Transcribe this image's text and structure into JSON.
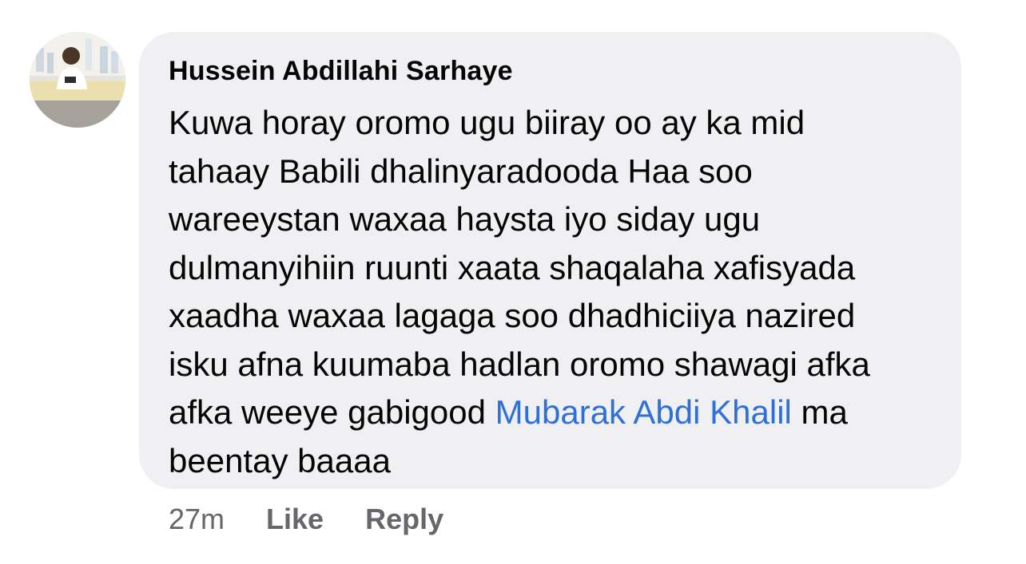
{
  "comment": {
    "author": "Hussein Abdillahi Sarhaye",
    "text_before_mention": "Kuwa horay oromo ugu biiray oo ay ka mid\ntahaay Babili dhalinyaradooda  Haa soo\nwareeystan waxaa haysta iyo siday ugu\ndulmanyihiin ruunti xaata shaqalaha xafisyada\nxaadha waxaa lagaga soo dhadhiciiya nazired\nisku afna kuumaba hadlan oromo shawagi afka\nafka weeye gabigood ",
    "mention": "Mubarak Abdi Khalil",
    "text_after_mention": " ma\nbeentay baaaa",
    "timestamp": "27m",
    "like_label": "Like",
    "reply_label": "Reply"
  },
  "colors": {
    "bubble_background": "#f0f0f2",
    "mention": "#2f6fd6",
    "secondary_text": "#65676b",
    "primary_text": "#050505"
  },
  "icons": {
    "avatar": "profile-photo"
  }
}
